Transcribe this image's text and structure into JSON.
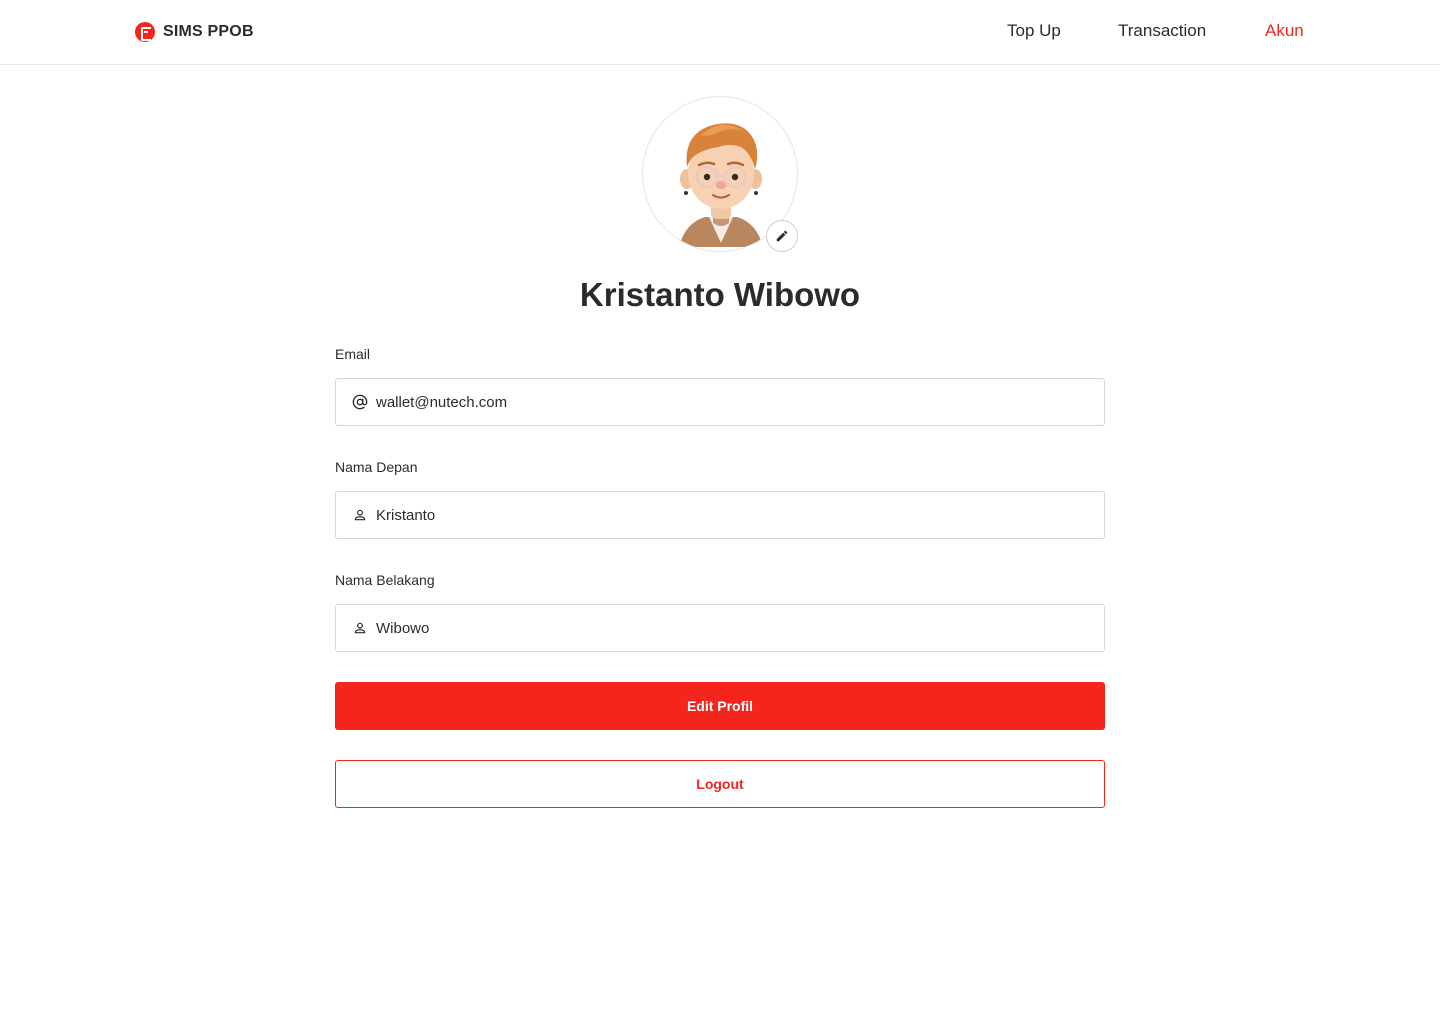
{
  "brand": {
    "name": "SIMS PPOB",
    "logo_icon": "sims-logo-icon"
  },
  "nav": {
    "top_up": "Top Up",
    "transaction": "Transaction",
    "akun": "Akun",
    "active": "Akun"
  },
  "profile": {
    "name": "Kristanto Wibowo",
    "avatar_icon": "user-avatar",
    "edit_avatar_icon": "pencil-icon"
  },
  "form": {
    "email": {
      "label": "Email",
      "value": "wallet@nutech.com",
      "icon": "at-icon"
    },
    "first_name": {
      "label": "Nama Depan",
      "value": "Kristanto",
      "icon": "person-icon"
    },
    "last_name": {
      "label": "Nama Belakang",
      "value": "Wibowo",
      "icon": "person-icon"
    }
  },
  "actions": {
    "edit_profile": "Edit Profil",
    "logout": "Logout"
  },
  "colors": {
    "accent": "#f3251d",
    "text": "#2b2b2b",
    "border": "#d6d6d6"
  }
}
